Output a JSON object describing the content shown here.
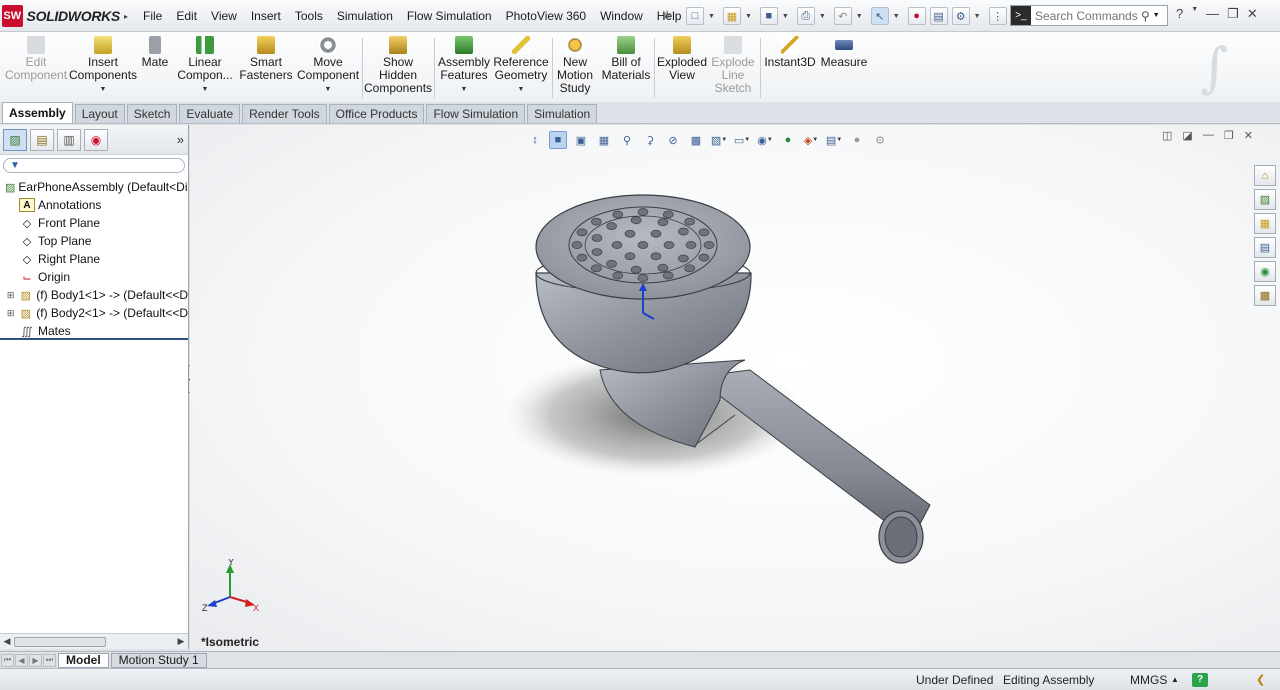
{
  "app": {
    "name": "SOLIDWORKS",
    "badge": "SW"
  },
  "menu": [
    "File",
    "Edit",
    "View",
    "Insert",
    "Tools",
    "Simulation",
    "Flow Simulation",
    "PhotoView 360",
    "Window",
    "Help"
  ],
  "search": {
    "placeholder": "Search Commands"
  },
  "ribbon": {
    "edit_component": [
      "Edit",
      "Component"
    ],
    "insert_components": [
      "Insert",
      "Components"
    ],
    "mate": [
      "Mate"
    ],
    "linear_component": [
      "Linear",
      "Compon..."
    ],
    "smart_fasteners": [
      "Smart",
      "Fasteners"
    ],
    "move_component": [
      "Move",
      "Component"
    ],
    "show_hidden": [
      "Show",
      "Hidden",
      "Components"
    ],
    "assembly_features": [
      "Assembly",
      "Features"
    ],
    "reference_geometry": [
      "Reference",
      "Geometry"
    ],
    "new_motion_study": [
      "New",
      "Motion",
      "Study"
    ],
    "bill_of_materials": [
      "Bill of",
      "Materials"
    ],
    "exploded_view": [
      "Exploded",
      "View"
    ],
    "explode_line_sketch": [
      "Explode",
      "Line",
      "Sketch"
    ],
    "instant3d": [
      "Instant3D"
    ],
    "measure": [
      "Measure"
    ]
  },
  "tabs": [
    "Assembly",
    "Layout",
    "Sketch",
    "Evaluate",
    "Render Tools",
    "Office Products",
    "Flow Simulation",
    "Simulation"
  ],
  "tree": {
    "root": "EarPhoneAssembly  (Default<Disp",
    "annotations": "Annotations",
    "front_plane": "Front Plane",
    "top_plane": "Top Plane",
    "right_plane": "Right Plane",
    "origin": "Origin",
    "body1": "(f) Body1<1> -> (Default<<D",
    "body2": "(f) Body2<1> -> (Default<<D",
    "mates": "Mates"
  },
  "graphics": {
    "view_name": "*Isometric",
    "triad": {
      "x": "X",
      "y": "Y",
      "z": "Z"
    }
  },
  "bottom_tabs": [
    "Model",
    "Motion Study 1"
  ],
  "status": {
    "definition": "Under Defined",
    "mode": "Editing Assembly",
    "units": "MMGS",
    "help": "?"
  },
  "colors": {
    "brand": "#c8102e",
    "accent": "#2c4f86",
    "model": "#8a8f99"
  }
}
